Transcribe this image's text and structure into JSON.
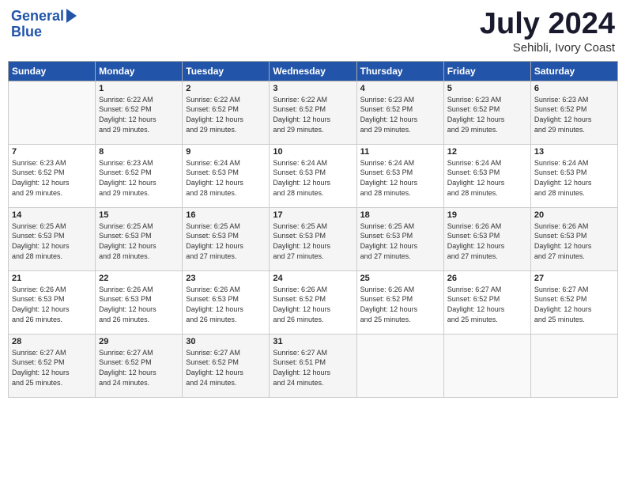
{
  "header": {
    "logo_line1": "General",
    "logo_line2": "Blue",
    "month": "July 2024",
    "location": "Sehibli, Ivory Coast"
  },
  "days_of_week": [
    "Sunday",
    "Monday",
    "Tuesday",
    "Wednesday",
    "Thursday",
    "Friday",
    "Saturday"
  ],
  "weeks": [
    [
      {
        "day": "",
        "content": ""
      },
      {
        "day": "1",
        "content": "Sunrise: 6:22 AM\nSunset: 6:52 PM\nDaylight: 12 hours\nand 29 minutes."
      },
      {
        "day": "2",
        "content": "Sunrise: 6:22 AM\nSunset: 6:52 PM\nDaylight: 12 hours\nand 29 minutes."
      },
      {
        "day": "3",
        "content": "Sunrise: 6:22 AM\nSunset: 6:52 PM\nDaylight: 12 hours\nand 29 minutes."
      },
      {
        "day": "4",
        "content": "Sunrise: 6:23 AM\nSunset: 6:52 PM\nDaylight: 12 hours\nand 29 minutes."
      },
      {
        "day": "5",
        "content": "Sunrise: 6:23 AM\nSunset: 6:52 PM\nDaylight: 12 hours\nand 29 minutes."
      },
      {
        "day": "6",
        "content": "Sunrise: 6:23 AM\nSunset: 6:52 PM\nDaylight: 12 hours\nand 29 minutes."
      }
    ],
    [
      {
        "day": "7",
        "content": "Sunrise: 6:23 AM\nSunset: 6:52 PM\nDaylight: 12 hours\nand 29 minutes."
      },
      {
        "day": "8",
        "content": "Sunrise: 6:23 AM\nSunset: 6:52 PM\nDaylight: 12 hours\nand 29 minutes."
      },
      {
        "day": "9",
        "content": "Sunrise: 6:24 AM\nSunset: 6:53 PM\nDaylight: 12 hours\nand 28 minutes."
      },
      {
        "day": "10",
        "content": "Sunrise: 6:24 AM\nSunset: 6:53 PM\nDaylight: 12 hours\nand 28 minutes."
      },
      {
        "day": "11",
        "content": "Sunrise: 6:24 AM\nSunset: 6:53 PM\nDaylight: 12 hours\nand 28 minutes."
      },
      {
        "day": "12",
        "content": "Sunrise: 6:24 AM\nSunset: 6:53 PM\nDaylight: 12 hours\nand 28 minutes."
      },
      {
        "day": "13",
        "content": "Sunrise: 6:24 AM\nSunset: 6:53 PM\nDaylight: 12 hours\nand 28 minutes."
      }
    ],
    [
      {
        "day": "14",
        "content": "Sunrise: 6:25 AM\nSunset: 6:53 PM\nDaylight: 12 hours\nand 28 minutes."
      },
      {
        "day": "15",
        "content": "Sunrise: 6:25 AM\nSunset: 6:53 PM\nDaylight: 12 hours\nand 28 minutes."
      },
      {
        "day": "16",
        "content": "Sunrise: 6:25 AM\nSunset: 6:53 PM\nDaylight: 12 hours\nand 27 minutes."
      },
      {
        "day": "17",
        "content": "Sunrise: 6:25 AM\nSunset: 6:53 PM\nDaylight: 12 hours\nand 27 minutes."
      },
      {
        "day": "18",
        "content": "Sunrise: 6:25 AM\nSunset: 6:53 PM\nDaylight: 12 hours\nand 27 minutes."
      },
      {
        "day": "19",
        "content": "Sunrise: 6:26 AM\nSunset: 6:53 PM\nDaylight: 12 hours\nand 27 minutes."
      },
      {
        "day": "20",
        "content": "Sunrise: 6:26 AM\nSunset: 6:53 PM\nDaylight: 12 hours\nand 27 minutes."
      }
    ],
    [
      {
        "day": "21",
        "content": "Sunrise: 6:26 AM\nSunset: 6:53 PM\nDaylight: 12 hours\nand 26 minutes."
      },
      {
        "day": "22",
        "content": "Sunrise: 6:26 AM\nSunset: 6:53 PM\nDaylight: 12 hours\nand 26 minutes."
      },
      {
        "day": "23",
        "content": "Sunrise: 6:26 AM\nSunset: 6:53 PM\nDaylight: 12 hours\nand 26 minutes."
      },
      {
        "day": "24",
        "content": "Sunrise: 6:26 AM\nSunset: 6:52 PM\nDaylight: 12 hours\nand 26 minutes."
      },
      {
        "day": "25",
        "content": "Sunrise: 6:26 AM\nSunset: 6:52 PM\nDaylight: 12 hours\nand 25 minutes."
      },
      {
        "day": "26",
        "content": "Sunrise: 6:27 AM\nSunset: 6:52 PM\nDaylight: 12 hours\nand 25 minutes."
      },
      {
        "day": "27",
        "content": "Sunrise: 6:27 AM\nSunset: 6:52 PM\nDaylight: 12 hours\nand 25 minutes."
      }
    ],
    [
      {
        "day": "28",
        "content": "Sunrise: 6:27 AM\nSunset: 6:52 PM\nDaylight: 12 hours\nand 25 minutes."
      },
      {
        "day": "29",
        "content": "Sunrise: 6:27 AM\nSunset: 6:52 PM\nDaylight: 12 hours\nand 24 minutes."
      },
      {
        "day": "30",
        "content": "Sunrise: 6:27 AM\nSunset: 6:52 PM\nDaylight: 12 hours\nand 24 minutes."
      },
      {
        "day": "31",
        "content": "Sunrise: 6:27 AM\nSunset: 6:51 PM\nDaylight: 12 hours\nand 24 minutes."
      },
      {
        "day": "",
        "content": ""
      },
      {
        "day": "",
        "content": ""
      },
      {
        "day": "",
        "content": ""
      }
    ]
  ]
}
